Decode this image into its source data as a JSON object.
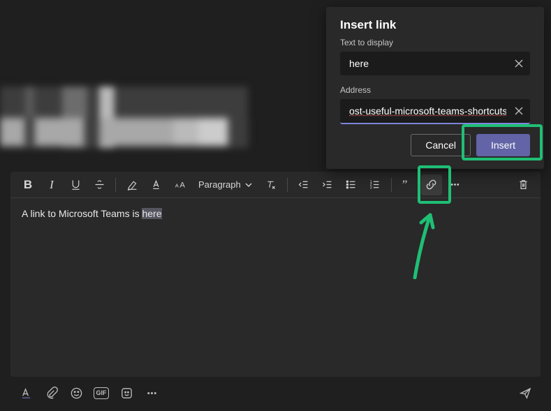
{
  "dialog": {
    "title": "Insert link",
    "text_label": "Text to display",
    "text_value": "here",
    "address_label": "Address",
    "address_value": "ost-useful-microsoft-teams-shortcuts/",
    "cancel_label": "Cancel",
    "insert_label": "Insert"
  },
  "toolbar": {
    "paragraph_label": "Paragraph"
  },
  "editor": {
    "prefix_text": "A link to Microsoft Teams is ",
    "selected_text": "here"
  },
  "bottom": {
    "gif_label": "GIF"
  },
  "colors": {
    "accent": "#6264a7",
    "highlight": "#1fbf75"
  }
}
